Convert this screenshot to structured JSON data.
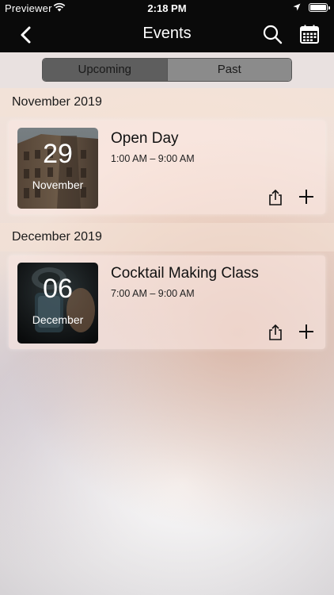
{
  "status_bar": {
    "carrier": "Previewer",
    "time": "2:18 PM",
    "icons": [
      "wifi-icon",
      "location-arrow-icon",
      "battery-icon"
    ]
  },
  "navbar": {
    "title": "Events",
    "left_icon": "chevron-left-icon",
    "right_icons": [
      "search-icon",
      "calendar-icon"
    ]
  },
  "segments": {
    "upcoming": "Upcoming",
    "past": "Past",
    "selected": "Upcoming"
  },
  "sections": [
    {
      "header": "November 2019",
      "event": {
        "title": "Open Day",
        "time": "1:00 AM – 9:00 AM",
        "day": "29",
        "month": "November",
        "thumbnail": "building-photo"
      }
    },
    {
      "header": "December 2019",
      "event": {
        "title": "Cocktail Making Class",
        "time": "7:00 AM – 9:00 AM",
        "day": "06",
        "month": "December",
        "thumbnail": "cocktail-bar-photo"
      }
    }
  ],
  "card_actions": [
    "share-icon",
    "add-icon"
  ],
  "colors": {
    "bar_background": "#0a0a0a",
    "segment_active": "#5e5e5e",
    "segment_inactive": "#8b8b8b"
  }
}
